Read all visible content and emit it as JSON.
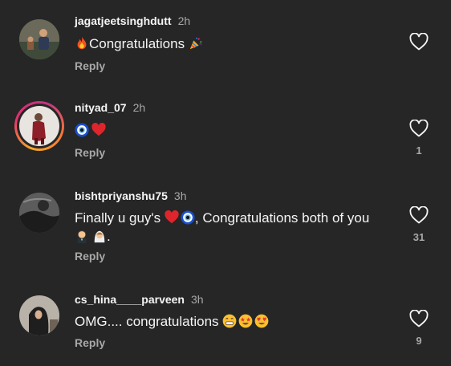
{
  "comments": [
    {
      "username": "jagatjeetsinghdutt",
      "time": "2h",
      "text": "Congratulations",
      "reply": "Reply",
      "likes": "",
      "emojis_before": [
        "fire-emoji"
      ],
      "emojis_after": [
        "party-popper-emoji"
      ]
    },
    {
      "username": "nityad_07",
      "time": "2h",
      "text": "",
      "reply": "Reply",
      "likes": "1",
      "emojis": [
        "nazar-amulet-emoji",
        "red-heart-emoji"
      ]
    },
    {
      "username": "bishtpriyanshu75",
      "time": "3h",
      "text_line1_a": "Finally u guy's ",
      "text_line1_b": ", Congratulations both of you",
      "text_line2_end": ".",
      "reply": "Reply",
      "likes": "31",
      "emojis_line1": [
        "red-heart-emoji",
        "nazar-amulet-emoji"
      ],
      "emojis_line2": [
        "groom-emoji",
        "bride-emoji"
      ]
    },
    {
      "username": "cs_hina____parveen",
      "time": "3h",
      "text": "OMG.... congratulations ",
      "reply": "Reply",
      "likes": "9",
      "emojis_after": [
        "grinning-emoji",
        "star-struck-emoji",
        "heart-eyes-emoji"
      ]
    }
  ],
  "colors": {
    "background": "#262626",
    "primary_text": "#f5f5f5",
    "secondary_text": "#a8a8a8"
  }
}
